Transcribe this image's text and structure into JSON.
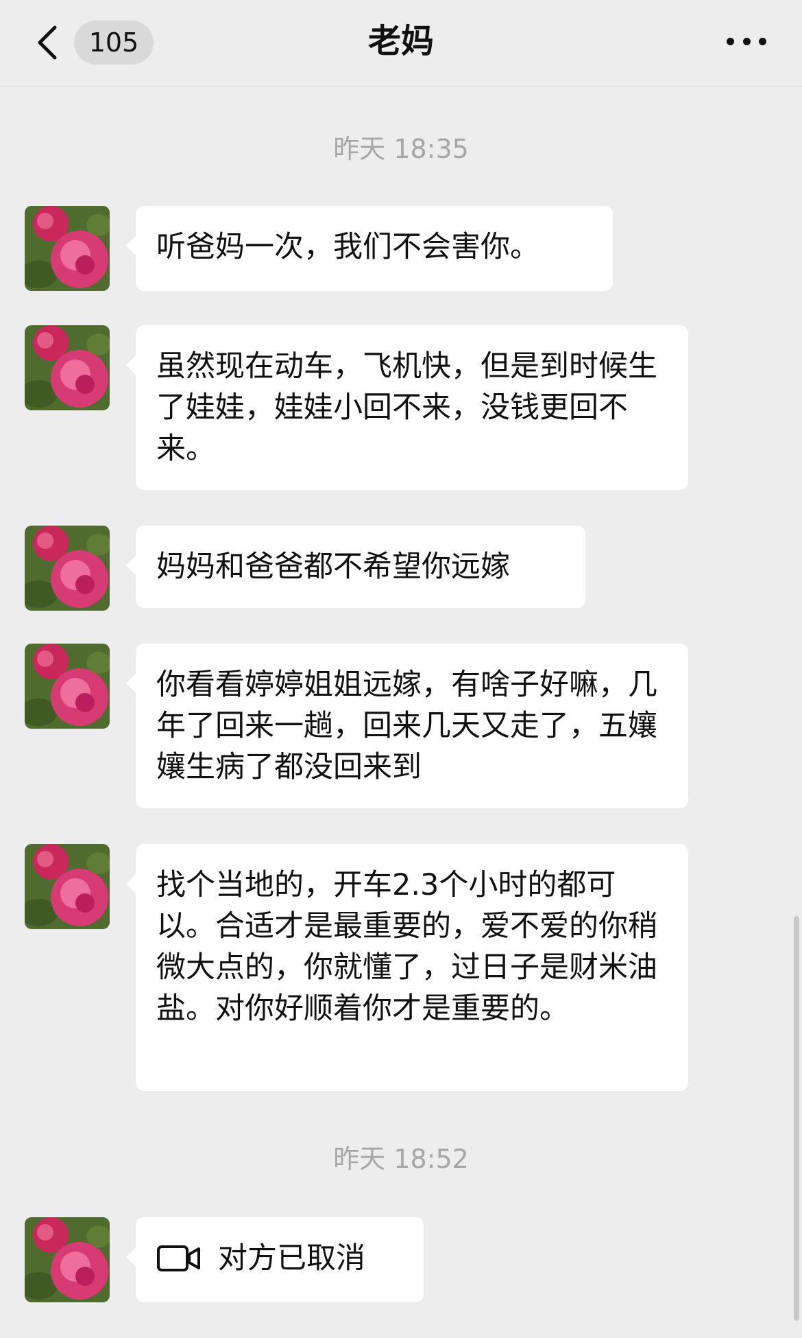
{
  "header": {
    "back_label": "back",
    "unread_count": "105",
    "title": "老妈"
  },
  "messages": [
    {
      "type": "time",
      "text": "昨天 18:35"
    },
    {
      "type": "text",
      "text": "听爸妈一次，我们不会害你。"
    },
    {
      "type": "text",
      "text": "虽然现在动车，飞机快，但是到时候生了娃娃，娃娃小回不来，没钱更回不来。"
    },
    {
      "type": "text",
      "text": "妈妈和爸爸都不希望你远嫁"
    },
    {
      "type": "text",
      "text": "你看看婷婷姐姐远嫁，有啥子好嘛，几年了回来一趟，回来几天又走了，五孃孃生病了都没回来到"
    },
    {
      "type": "text",
      "text": "找个当地的，开车2.3个小时的都可以。合适才是最重要的，爱不爱的你稍微大点的，你就懂了，过日子是财米油盐。对你好顺着你才是重要的。"
    },
    {
      "type": "time",
      "text": "昨天 18:52"
    },
    {
      "type": "call",
      "text": "对方已取消",
      "icon": "video-call-icon"
    }
  ],
  "colors": {
    "background": "#ededed",
    "bubble": "#ffffff",
    "timestamp": "#a6a6a6",
    "badge": "#d9d9d9"
  }
}
